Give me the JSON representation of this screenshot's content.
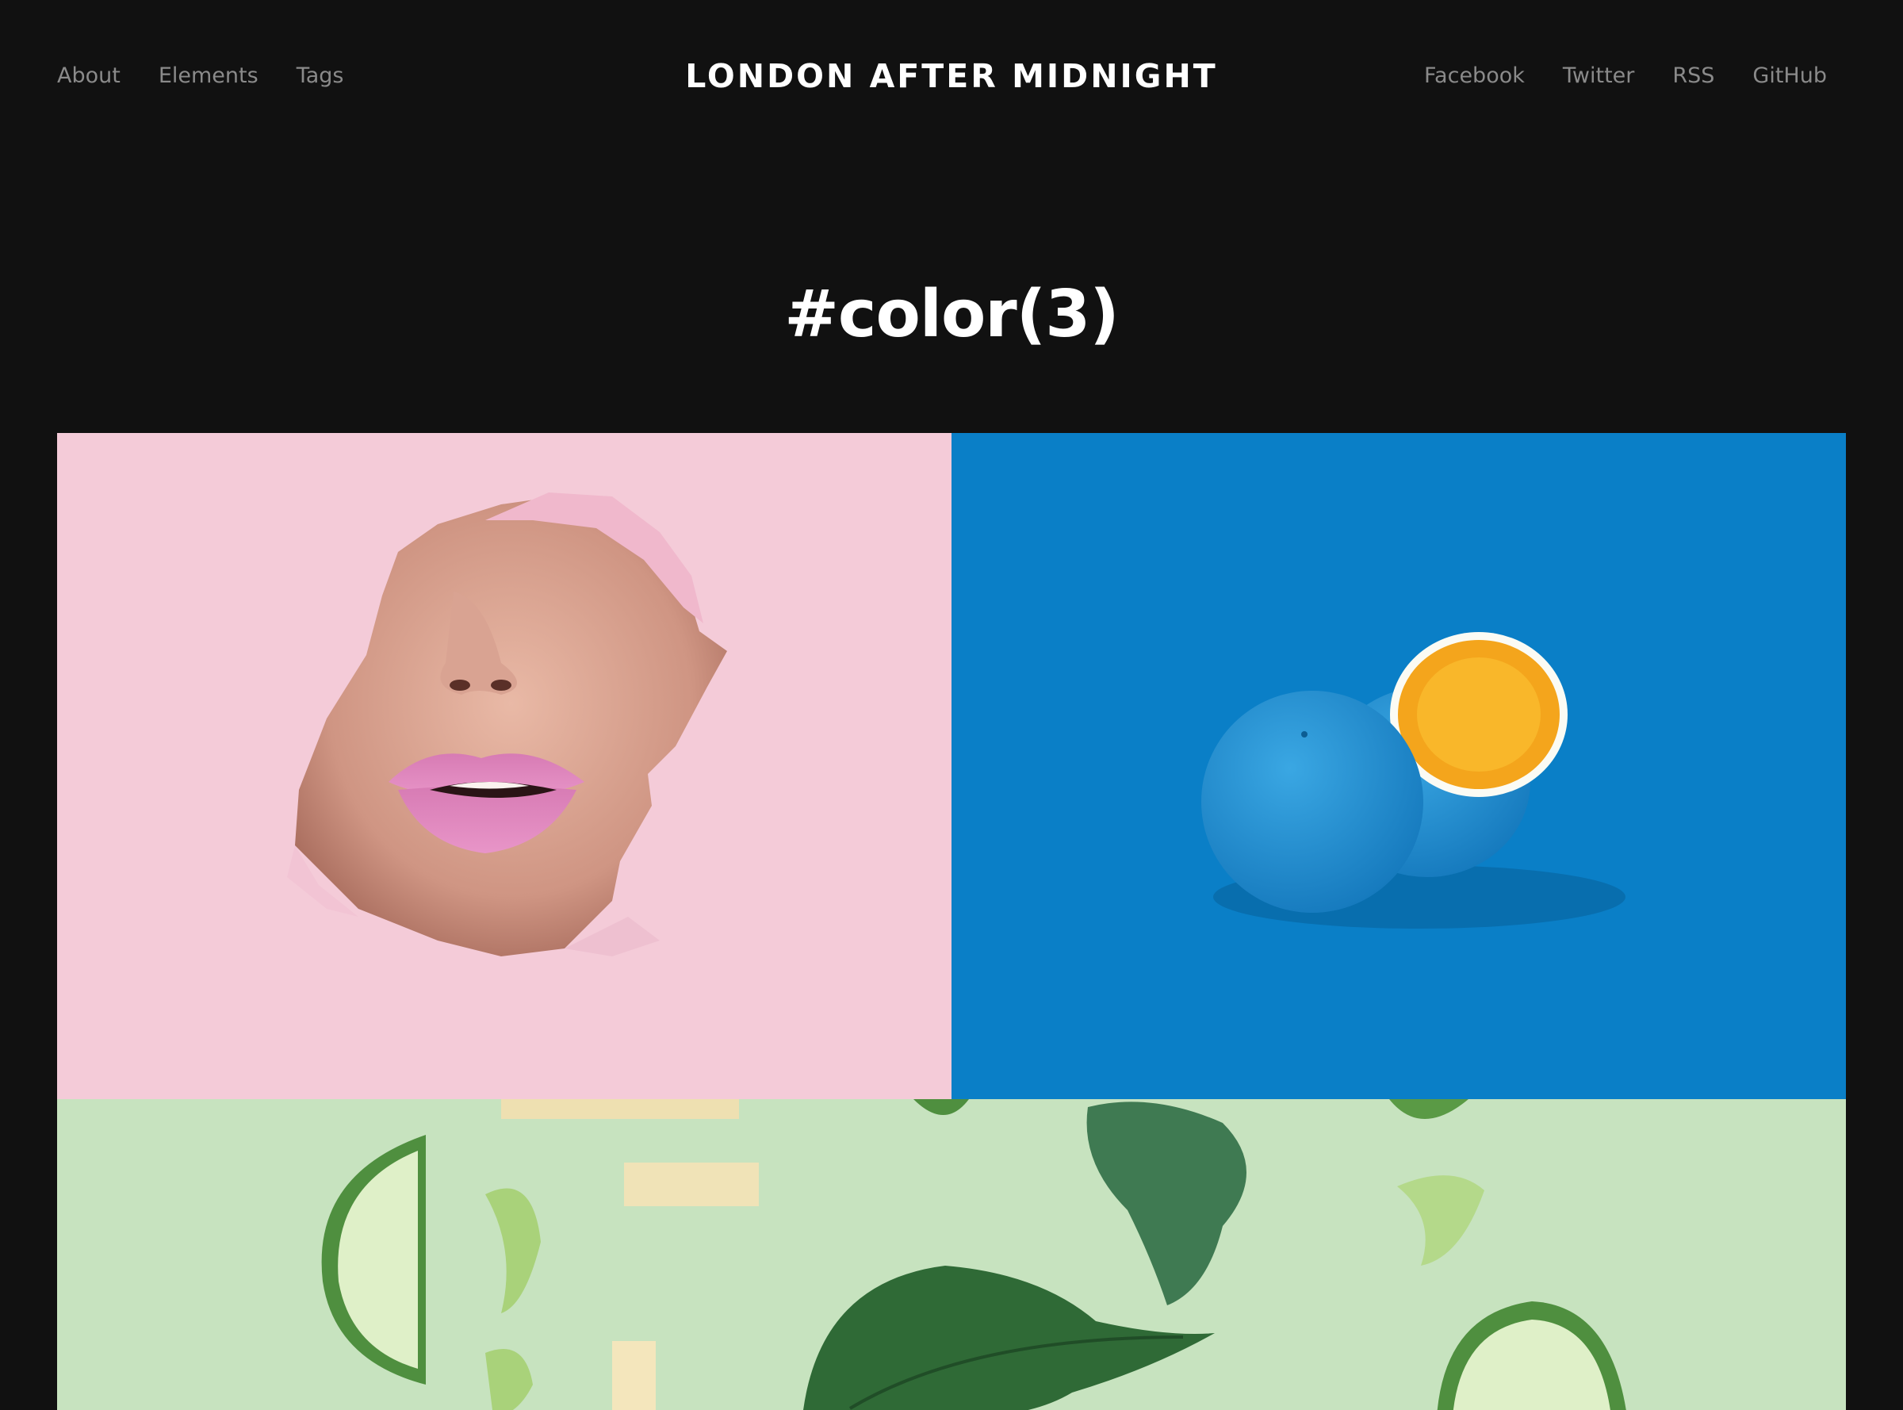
{
  "header": {
    "nav_left": [
      {
        "label": "About"
      },
      {
        "label": "Elements"
      },
      {
        "label": "Tags"
      }
    ],
    "site_title": "LONDON AFTER MIDNIGHT",
    "nav_right": [
      {
        "label": "Facebook"
      },
      {
        "label": "Twitter"
      },
      {
        "label": "RSS"
      },
      {
        "label": "GitHub"
      }
    ]
  },
  "main": {
    "tag_title": "#color(3)"
  },
  "colors": {
    "background": "#111111",
    "nav_text": "#8a8a8a",
    "title_text": "#ffffff",
    "card_pink": "#f4cbd8",
    "card_blue": "#0a7fc7",
    "card_green": "#c7e3bf"
  }
}
